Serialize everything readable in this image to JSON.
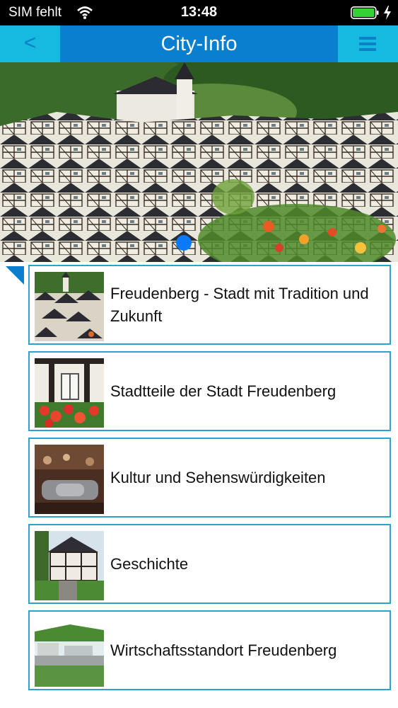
{
  "status_bar": {
    "carrier": "SIM fehlt",
    "time": "13:48",
    "battery_color": "#35d235"
  },
  "nav": {
    "back_label": "<",
    "title": "City-Info",
    "accent_dark": "#0a7fd0",
    "accent_light": "#16b9e0"
  },
  "hero": {
    "image": "town-panorama",
    "active_page": 1
  },
  "list": {
    "items": [
      {
        "label": "Freudenberg - Stadt mit Tradition und Zukunft",
        "thumb": "town-roofs-thumb"
      },
      {
        "label": "Stadtteile der Stadt Freudenberg",
        "thumb": "window-flowers-thumb"
      },
      {
        "label": "Kultur und Sehenswürdigkeiten",
        "thumb": "museum-thumb"
      },
      {
        "label": "Geschichte",
        "thumb": "timber-house-thumb"
      },
      {
        "label": "Wirtschaftsstandort Freudenberg",
        "thumb": "industrial-park-thumb"
      }
    ]
  }
}
